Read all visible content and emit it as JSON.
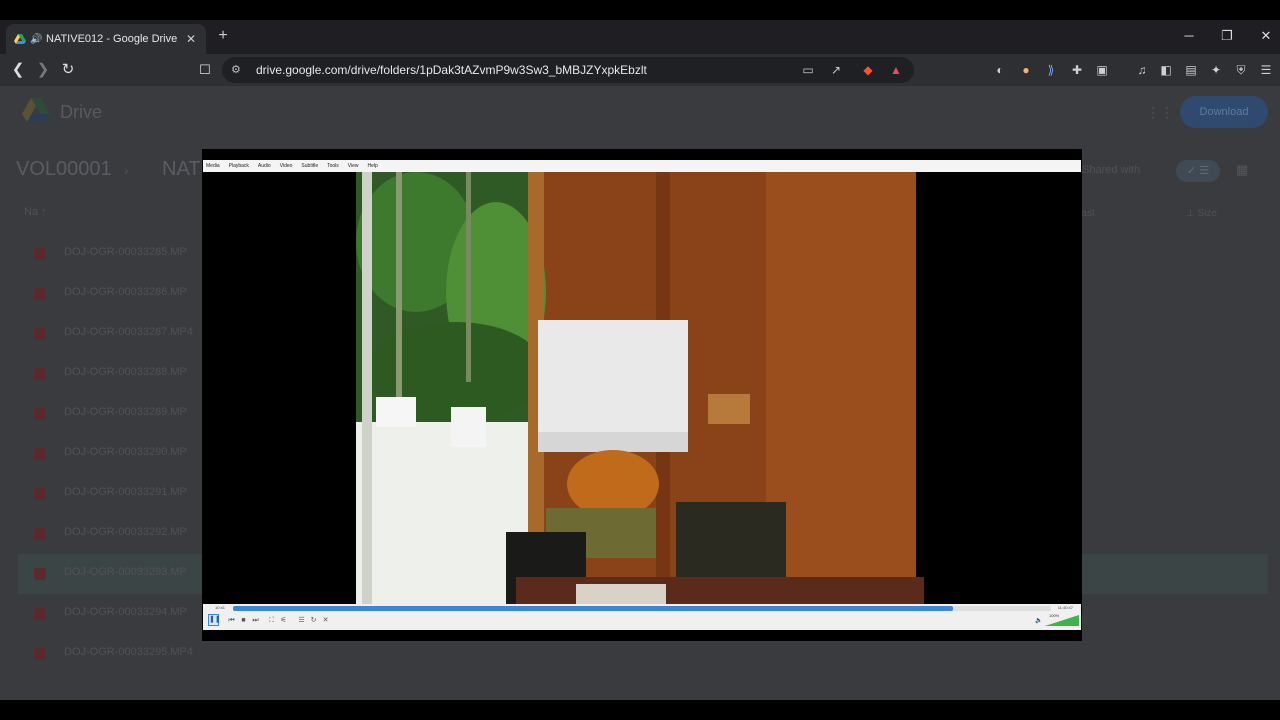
{
  "browser": {
    "tab": {
      "title": "NATIVE012 - Google Drive",
      "audio_icon": "speaker-icon",
      "close_label": "✕"
    },
    "new_tab_label": "+",
    "window_controls": {
      "minimize": "─",
      "restore": "❐",
      "close": "✕"
    },
    "nav": {
      "back": "❮",
      "forward": "❯",
      "reload": "↻",
      "bookmark": "🔖"
    },
    "address": {
      "url": "drive.google.com/drive/folders/1pDak3tAZvmP9w3Sw3_bMBJZYxpkEbzlt"
    }
  },
  "drive": {
    "brand": "Drive",
    "upload_label": "Download",
    "breadcrumb": [
      "VOL00001",
      "NAT"
    ],
    "view_toggle": "✓ ☰",
    "header_right": "Shared with",
    "sort_label": "Na ↑",
    "meta_headers": [
      "Last",
      "⊥ Size"
    ],
    "files": [
      {
        "name": "DOJ-OGR-00033285.MP",
        "owner": "",
        "modified": "",
        "size": ""
      },
      {
        "name": "DOJ-OGR-00033286.MP",
        "owner": "",
        "modified": "",
        "size": ""
      },
      {
        "name": "DOJ-OGR-00033287.MP4",
        "owner": "",
        "modified": "",
        "size": ""
      },
      {
        "name": "DOJ-OGR-00033288.MP",
        "owner": "",
        "modified": "",
        "size": ""
      },
      {
        "name": "DOJ-OGR-00033289.MP",
        "owner": "",
        "modified": "",
        "size": ""
      },
      {
        "name": "DOJ-OGR-00033290.MP",
        "owner": "",
        "modified": "",
        "size": ""
      },
      {
        "name": "DOJ-OGR-00033291.MP",
        "owner": "",
        "modified": "",
        "size": ""
      },
      {
        "name": "DOJ-OGR-00033292.MP",
        "owner": "",
        "modified": "",
        "size": ""
      },
      {
        "name": "DOJ-OGR-00033293.MP",
        "owner": "",
        "modified": "",
        "size": ""
      },
      {
        "name": "DOJ-OGR-00033294.MP",
        "owner": "",
        "modified": "",
        "size": ""
      },
      {
        "name": "DOJ-OGR-00033295.MP4",
        "owner": "",
        "modified": "",
        "size": ""
      }
    ],
    "selected_index": 8
  },
  "player": {
    "menu": [
      "Media",
      "Playback",
      "Audio",
      "Video",
      "Subtitle",
      "Tools",
      "View",
      "Help"
    ],
    "time_elapsed": "10:41",
    "time_total": "11:40:47",
    "progress": 0.88,
    "volume_label": "100%",
    "volume": 1.0
  },
  "colors": {
    "seek": "#3c86d8",
    "volume": "#3cb44b"
  }
}
